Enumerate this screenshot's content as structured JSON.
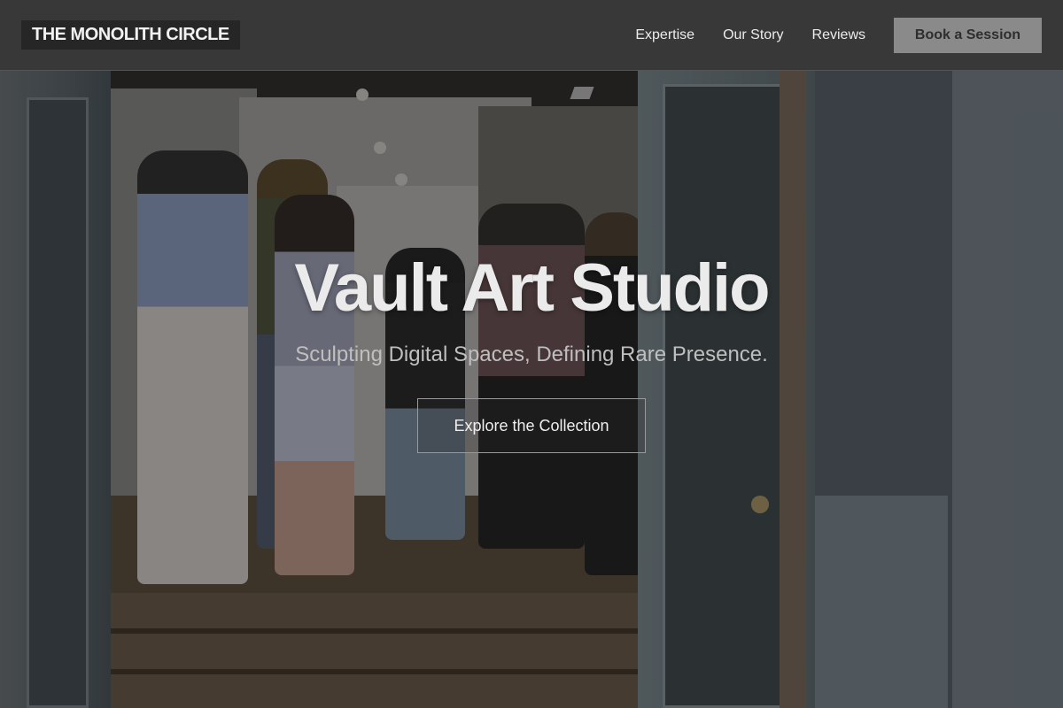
{
  "header": {
    "brand": "THE MONOLITH CIRCLE",
    "nav": [
      {
        "label": "Expertise"
      },
      {
        "label": "Our Story"
      },
      {
        "label": "Reviews"
      }
    ],
    "cta_label": "Book a Session"
  },
  "hero": {
    "title": "Vault Art Studio",
    "subtitle": "Sculpting Digital Spaces, Defining Rare Presence.",
    "button_label": "Explore the Collection",
    "background": "gallery-opening-photo"
  },
  "colors": {
    "header_bg": "#3a3a3a",
    "brand_bg": "#262626",
    "cta_bg": "#8a8a8a",
    "hero_text": "#ebebeb"
  }
}
